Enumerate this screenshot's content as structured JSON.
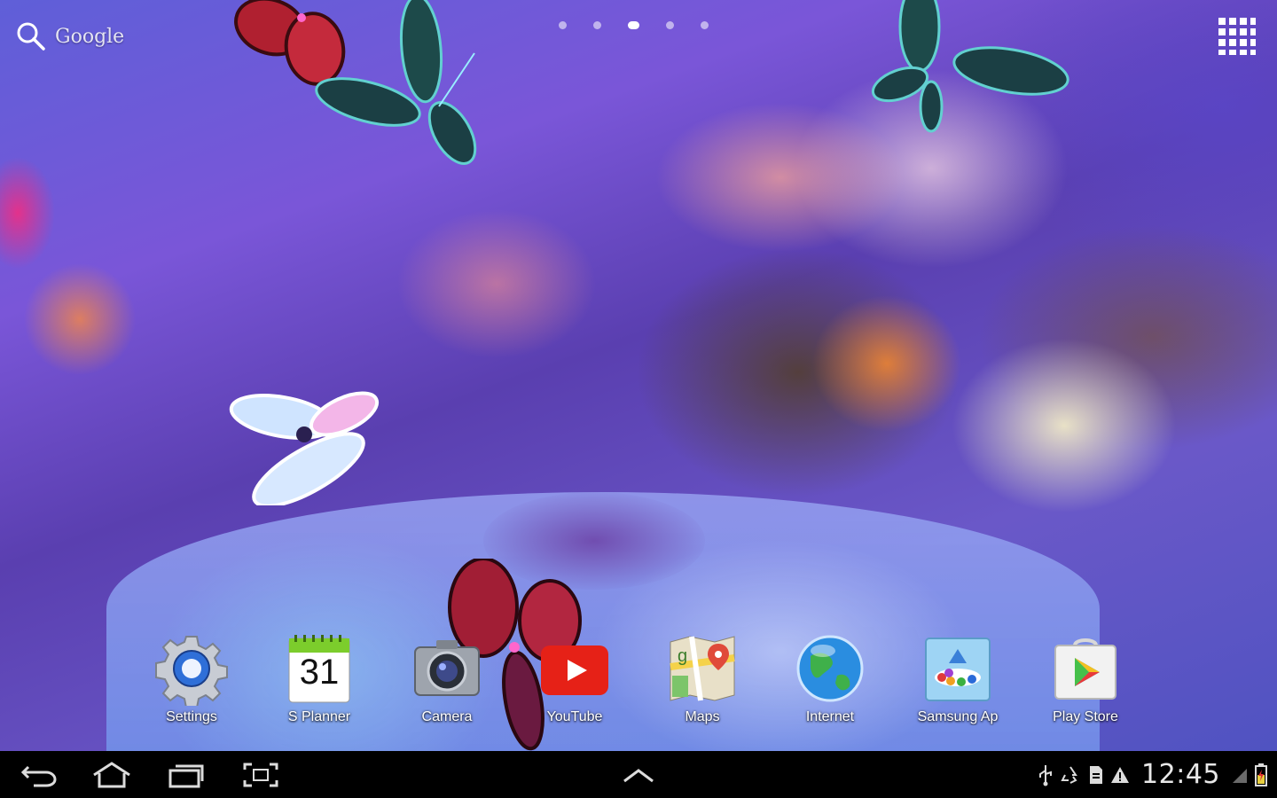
{
  "search": {
    "label": "Google"
  },
  "pages": {
    "count": 5,
    "active_index": 2
  },
  "dock": {
    "items": [
      {
        "id": "settings",
        "label": "Settings",
        "icon": "gear-icon"
      },
      {
        "id": "splanner",
        "label": "S Planner",
        "icon": "calendar-icon",
        "date": "31"
      },
      {
        "id": "camera",
        "label": "Camera",
        "icon": "camera-icon"
      },
      {
        "id": "youtube",
        "label": "YouTube",
        "icon": "youtube-icon"
      },
      {
        "id": "maps",
        "label": "Maps",
        "icon": "maps-icon"
      },
      {
        "id": "internet",
        "label": "Internet",
        "icon": "globe-icon"
      },
      {
        "id": "samsung-apps",
        "label": "Samsung Ap",
        "icon": "samsung-apps-icon"
      },
      {
        "id": "play-store",
        "label": "Play Store",
        "icon": "play-store-icon"
      }
    ]
  },
  "navbar": {
    "buttons": [
      "back-icon",
      "home-icon",
      "recent-apps-icon",
      "screenshot-icon",
      "chevron-up-icon"
    ]
  },
  "status": {
    "time": "12:45",
    "icons": [
      "usb-icon",
      "recycle-icon",
      "sd-card-icon",
      "warning-icon",
      "signal-icon",
      "battery-icon"
    ]
  },
  "colors": {
    "navbar": "#000000",
    "youtube_red": "#e62117",
    "settings_blue": "#2f6fd8"
  }
}
